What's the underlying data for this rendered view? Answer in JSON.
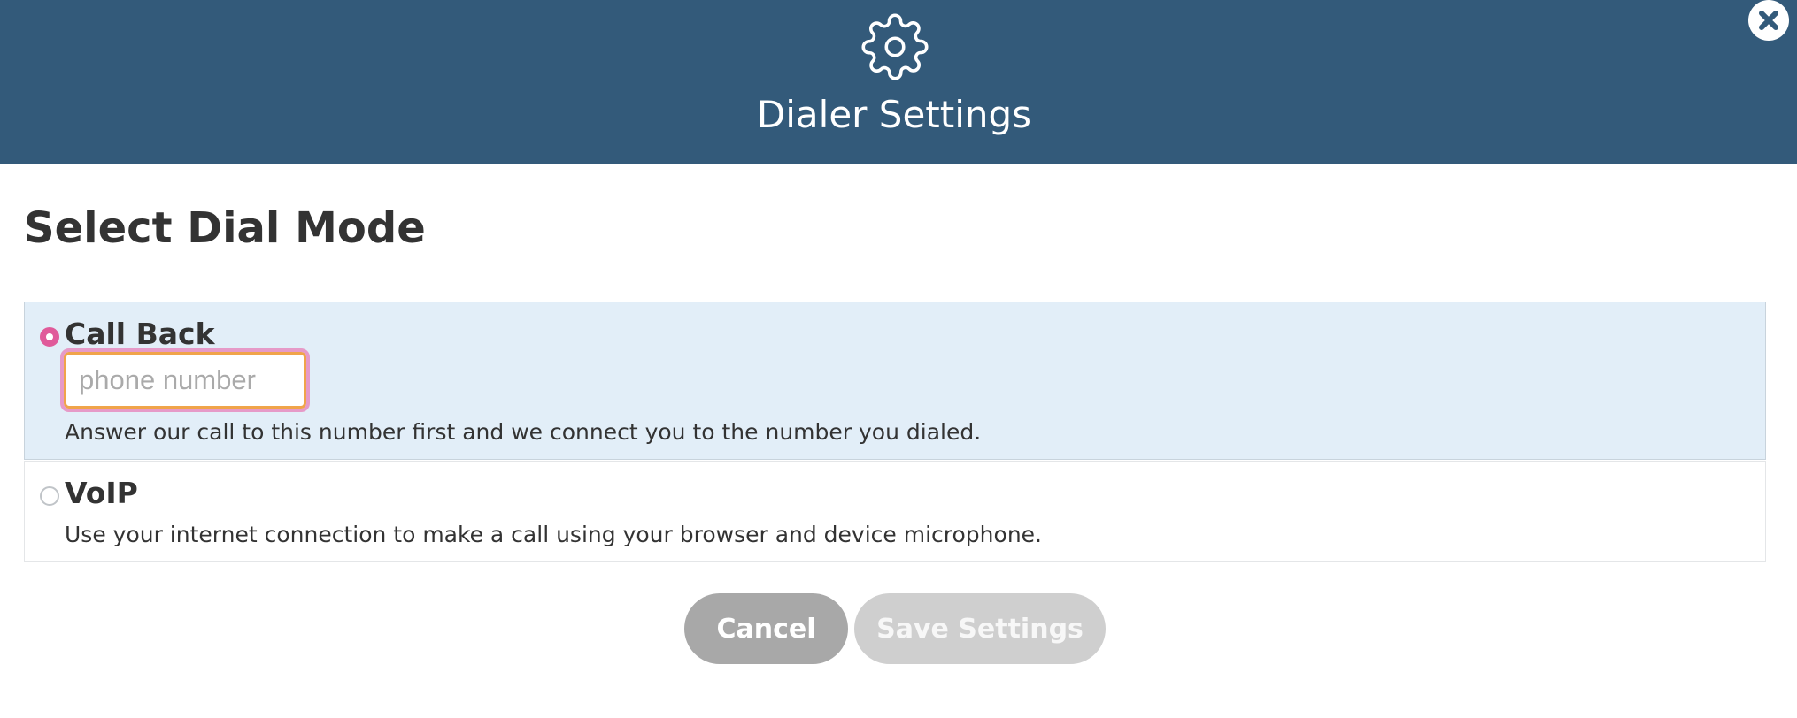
{
  "header": {
    "title": "Dialer Settings",
    "icon": "gear-icon",
    "background_color": "#335a7a"
  },
  "close_icon": "close-icon",
  "page_title": "Select Dial Mode",
  "options": [
    {
      "label": "Call Back",
      "selected": true,
      "input_placeholder": "phone number",
      "input_value": "",
      "description": "Answer our call to this number first and we connect you to the number you dialed."
    },
    {
      "label": "VoIP",
      "selected": false,
      "description": "Use your internet connection to make a call using your browser and device microphone."
    }
  ],
  "buttons": {
    "cancel_label": "Cancel",
    "save_label": "Save Settings"
  },
  "colors": {
    "accent": "#e05a9a",
    "selected_row": "#e2eef8",
    "input_border": "#f0a44a"
  }
}
